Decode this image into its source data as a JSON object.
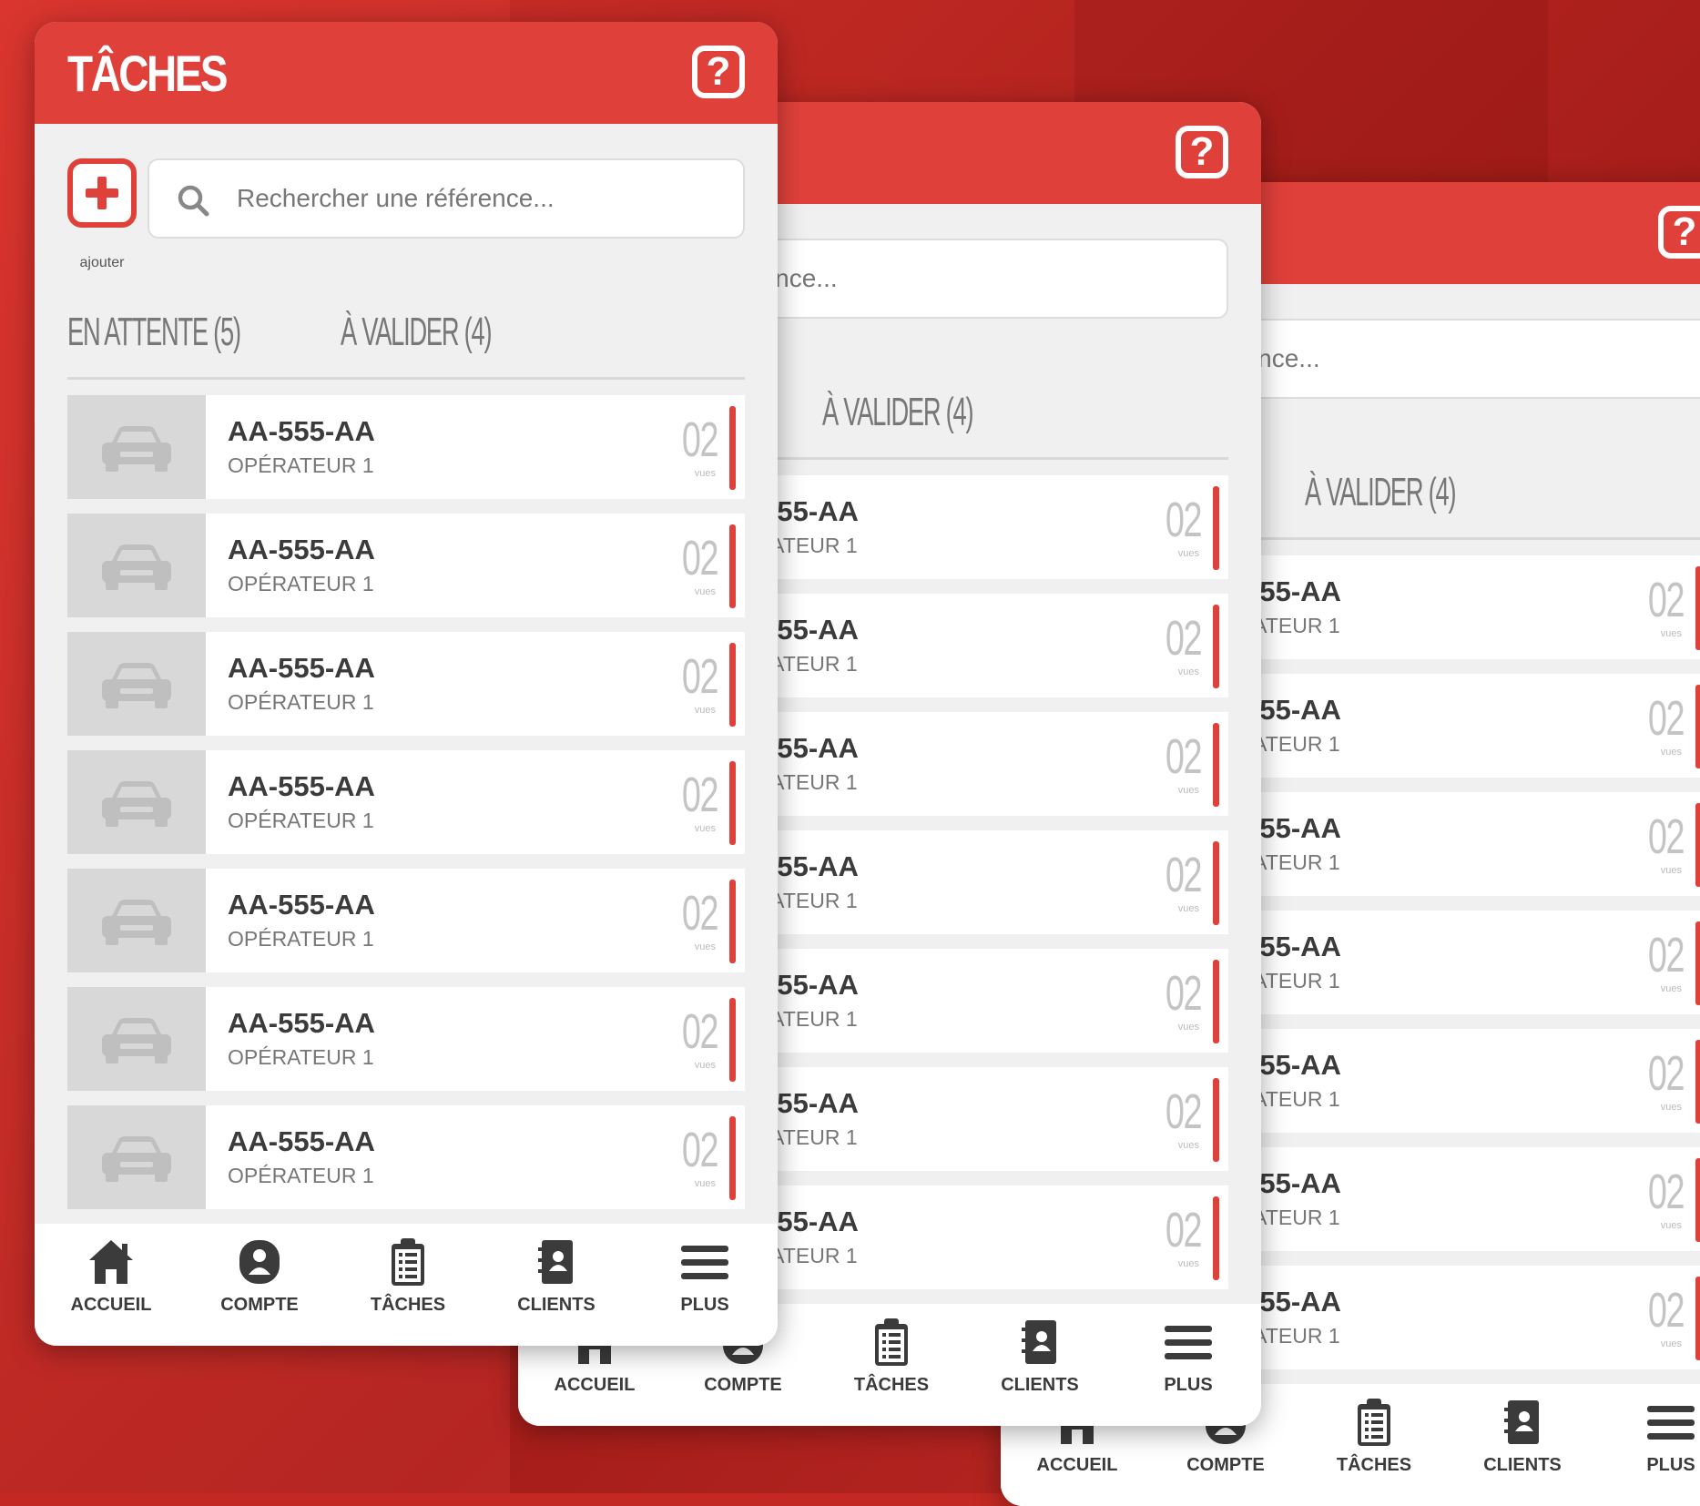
{
  "app": {
    "title": "TÂCHES",
    "help_glyph": "?",
    "add_label": "ajouter",
    "search_placeholder": "Rechercher une référence...",
    "tabs": [
      "EN ATTENTE (5)",
      "À VALIDER (4)"
    ],
    "accent_color": "#e0403a"
  },
  "rows": [
    {
      "ref": "AA-555-AA",
      "operator": "OPÉRATEUR 1",
      "count": "02",
      "unit": "vues"
    },
    {
      "ref": "AA-555-AA",
      "operator": "OPÉRATEUR 1",
      "count": "02",
      "unit": "vues"
    },
    {
      "ref": "AA-555-AA",
      "operator": "OPÉRATEUR 1",
      "count": "02",
      "unit": "vues"
    },
    {
      "ref": "AA-555-AA",
      "operator": "OPÉRATEUR 1",
      "count": "02",
      "unit": "vues"
    },
    {
      "ref": "AA-555-AA",
      "operator": "OPÉRATEUR 1",
      "count": "02",
      "unit": "vues"
    },
    {
      "ref": "AA-555-AA",
      "operator": "OPÉRATEUR 1",
      "count": "02",
      "unit": "vues"
    },
    {
      "ref": "AA-555-AA",
      "operator": "OPÉRATEUR 1",
      "count": "02",
      "unit": "vues"
    }
  ],
  "nav": [
    {
      "label": "ACCUEIL",
      "icon": "home-icon"
    },
    {
      "label": "COMPTE",
      "icon": "account-icon"
    },
    {
      "label": "TÂCHES",
      "icon": "clipboard-icon"
    },
    {
      "label": "CLIENTS",
      "icon": "contacts-book-icon"
    },
    {
      "label": "PLUS",
      "icon": "menu-icon"
    }
  ]
}
